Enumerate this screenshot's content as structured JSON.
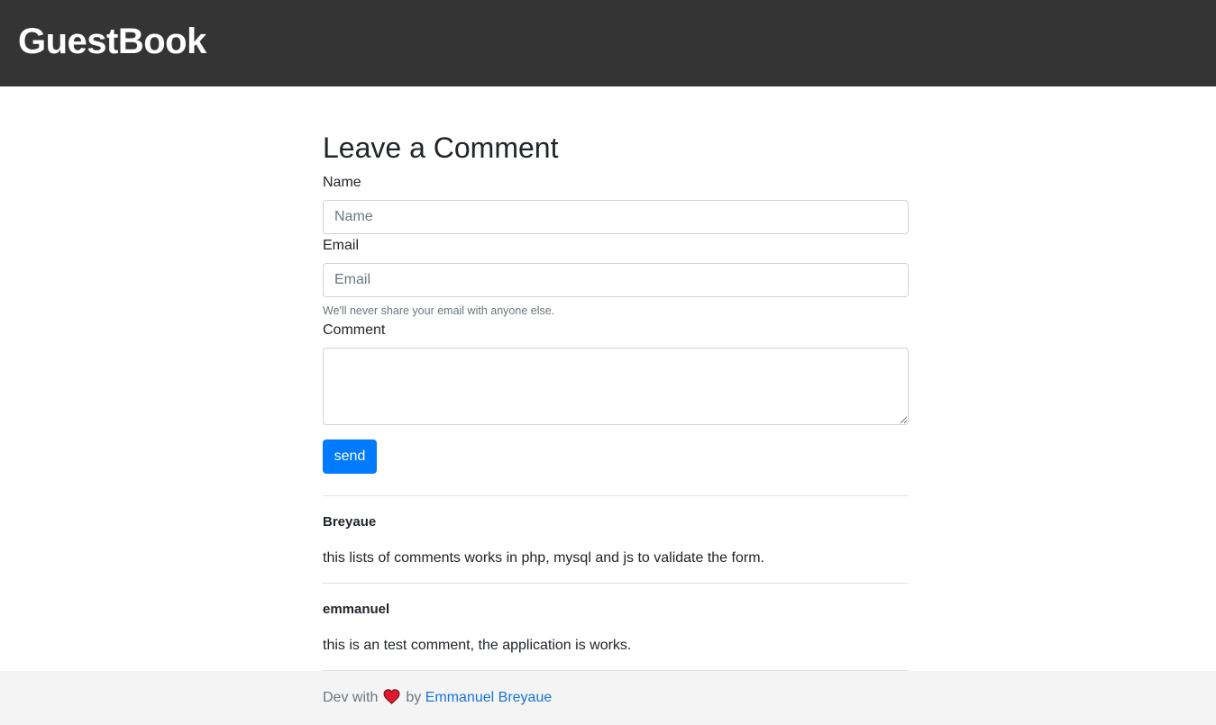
{
  "navbar": {
    "brand": "GuestBook"
  },
  "form": {
    "title": "Leave a Comment",
    "name_label": "Name",
    "name_placeholder": "Name",
    "name_value": "",
    "email_label": "Email",
    "email_placeholder": "Email",
    "email_value": "",
    "email_help": "We'll never share your email with anyone else.",
    "comment_label": "Comment",
    "comment_value": "",
    "submit_label": "send"
  },
  "comments": [
    {
      "author": "Breyaue",
      "text": "this lists of comments works in php, mysql and js to validate the form."
    },
    {
      "author": "emmanuel",
      "text": "this is an test comment, the application is works."
    }
  ],
  "footer": {
    "prefix": "Dev with",
    "heart_icon": "heart-icon",
    "by": "by",
    "author_link": "Emmanuel Breyaue"
  },
  "colors": {
    "navbar_bg": "#343434",
    "primary": "#007bff",
    "link": "#1a73d9",
    "heart": "#e0182d",
    "footer_bg": "#f4f4f4"
  }
}
